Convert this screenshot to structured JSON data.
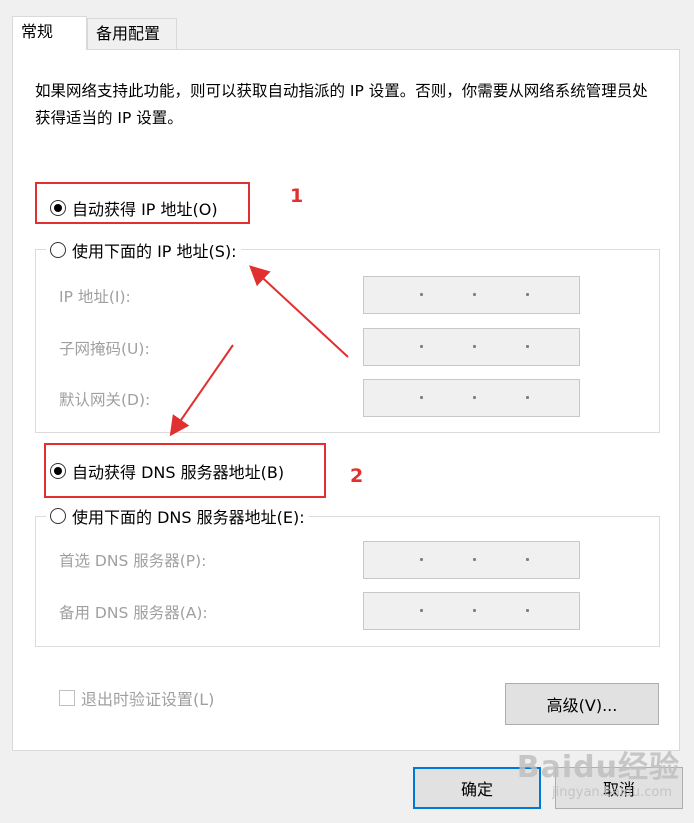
{
  "tabs": [
    {
      "label": "常规",
      "active": true
    },
    {
      "label": "备用配置",
      "active": false
    }
  ],
  "description": "如果网络支持此功能，则可以获取自动指派的 IP 设置。否则，你需要从网络系统管理员处获得适当的 IP 设置。",
  "ip_section": {
    "auto_radio_label": "自动获得 IP 地址(O)",
    "auto_checked": true,
    "manual_radio_label": "使用下面的 IP 地址(S):",
    "manual_checked": false,
    "fields": [
      {
        "label": "IP 地址(I):",
        "value": ". . ."
      },
      {
        "label": "子网掩码(U):",
        "value": ". . ."
      },
      {
        "label": "默认网关(D):",
        "value": ". . ."
      }
    ]
  },
  "dns_section": {
    "auto_radio_label": "自动获得 DNS 服务器地址(B)",
    "auto_checked": true,
    "manual_radio_label": "使用下面的 DNS 服务器地址(E):",
    "manual_checked": false,
    "fields": [
      {
        "label": "首选 DNS 服务器(P):",
        "value": ". . ."
      },
      {
        "label": "备用 DNS 服务器(A):",
        "value": ". . ."
      }
    ]
  },
  "validate_checkbox": {
    "label": "退出时验证设置(L)",
    "checked": false,
    "enabled": false
  },
  "buttons": {
    "advanced": "高级(V)...",
    "ok": "确定",
    "cancel": "取消"
  },
  "annotations": {
    "marker_1": "1",
    "marker_2": "2",
    "color": "#e03030"
  },
  "watermark": {
    "main": "Baidu经验",
    "sub": "jingyan.baidu.com"
  }
}
